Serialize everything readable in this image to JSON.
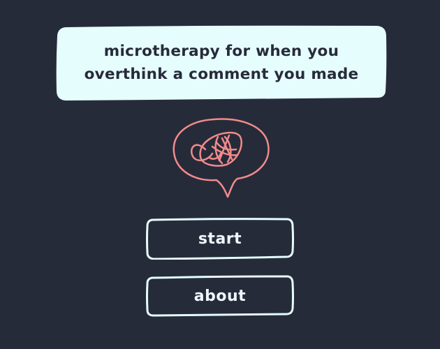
{
  "title_card": {
    "line1": "microtherapy for when you",
    "line2": "overthink a comment you made"
  },
  "logo": {
    "icon": "scribble-speech-bubble-icon",
    "color": "#f28b8b"
  },
  "menu": {
    "start_label": "start",
    "about_label": "about"
  },
  "colors": {
    "background": "#262b3a",
    "card": "#e6fdfe",
    "button_outline": "#e6fdfe",
    "text_light": "#eef7fa",
    "text_dark": "#262b3a"
  }
}
